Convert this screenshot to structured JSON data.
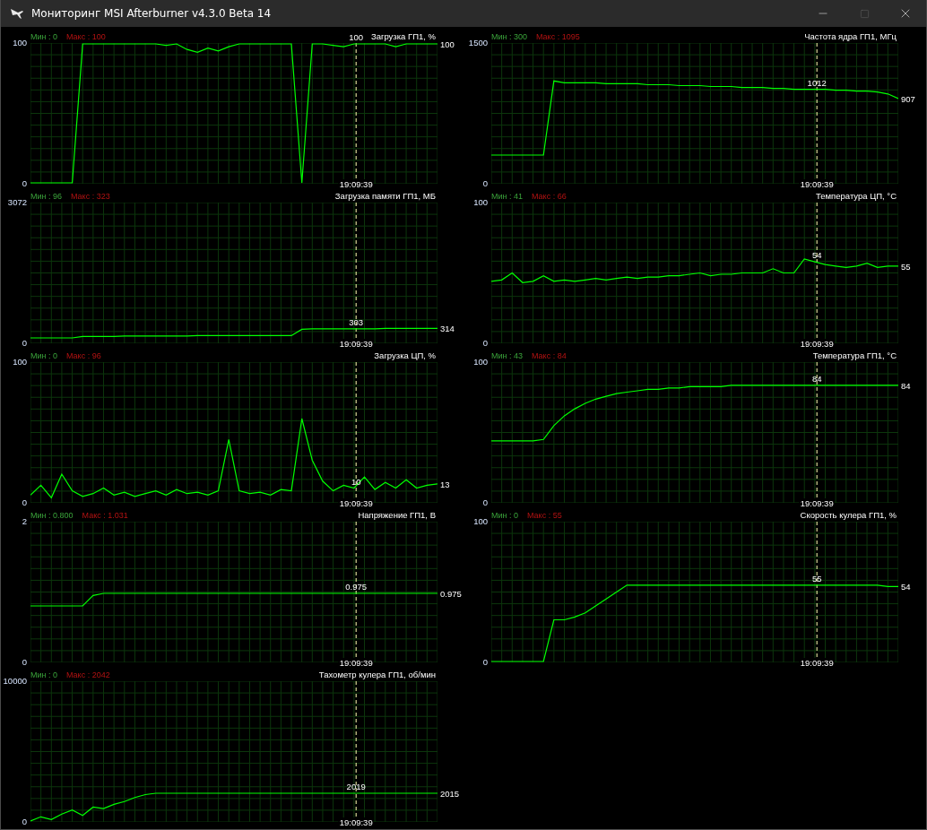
{
  "window": {
    "title": "Мониторинг MSI Afterburner v4.3.0 Beta 14"
  },
  "columns": [
    [
      {
        "min": "Мин : 0",
        "max": "Макс : 100",
        "cursor_value": "100",
        "last_value": "100",
        "time": "19:09:39",
        "chart_data": {
          "type": "line",
          "title": "Загрузка ГП1, %",
          "grid": true,
          "ylim": [
            0,
            100
          ],
          "yticks": [
            0,
            100
          ],
          "series": [
            {
              "color": "#00ff00",
              "values": [
                0,
                0,
                0,
                0,
                0,
                100,
                100,
                100,
                100,
                100,
                100,
                100,
                100,
                99,
                100,
                96,
                94,
                97,
                95,
                98,
                100,
                100,
                100,
                100,
                100,
                100,
                0,
                100,
                100,
                99,
                98,
                100,
                100,
                100,
                100,
                98,
                100,
                100,
                100,
                100
              ]
            }
          ]
        }
      },
      {
        "min": "Мин : 96",
        "max": "Макс : 323",
        "cursor_value": "303",
        "last_value": "314",
        "time": "19:09:39",
        "chart_data": {
          "type": "line",
          "title": "Загрузка памяти ГП1, МБ",
          "grid": true,
          "ylim": [
            0,
            3072
          ],
          "yticks": [
            0,
            3072
          ],
          "series": [
            {
              "color": "#00ff00",
              "values": [
                100,
                100,
                100,
                100,
                100,
                130,
                130,
                130,
                130,
                140,
                140,
                140,
                140,
                140,
                140,
                140,
                150,
                150,
                150,
                150,
                150,
                150,
                150,
                150,
                150,
                150,
                290,
                300,
                300,
                300,
                300,
                300,
                300,
                300,
                310,
                310,
                310,
                310,
                310,
                310
              ]
            }
          ]
        }
      },
      {
        "min": "Мин : 0",
        "max": "Макс : 96",
        "cursor_value": "10",
        "last_value": "13",
        "time": "19:09:39",
        "chart_data": {
          "type": "line",
          "title": "Загрузка ЦП, %",
          "grid": true,
          "ylim": [
            0,
            100
          ],
          "yticks": [
            0,
            100
          ],
          "series": [
            {
              "color": "#00ff00",
              "values": [
                5,
                12,
                3,
                20,
                8,
                4,
                6,
                10,
                5,
                7,
                4,
                6,
                8,
                5,
                9,
                6,
                7,
                5,
                8,
                45,
                8,
                6,
                7,
                5,
                9,
                8,
                60,
                30,
                15,
                8,
                12,
                10,
                18,
                9,
                14,
                10,
                16,
                10,
                12,
                13
              ]
            }
          ]
        }
      },
      {
        "min": "Мин : 0.800",
        "max": "Макс : 1.031",
        "cursor_value": "0.975",
        "last_value": "0.975",
        "time": "19:09:39",
        "chart_data": {
          "type": "line",
          "title": "Напряжение ГП1, В",
          "grid": true,
          "ylim": [
            0,
            2
          ],
          "yticks": [
            0,
            2
          ],
          "series": [
            {
              "color": "#00ff00",
              "values": [
                0.8,
                0.8,
                0.8,
                0.8,
                0.8,
                0.8,
                0.95,
                0.98,
                0.98,
                0.98,
                0.98,
                0.98,
                0.98,
                0.98,
                0.98,
                0.98,
                0.98,
                0.98,
                0.98,
                0.98,
                0.98,
                0.98,
                0.98,
                0.98,
                0.98,
                0.98,
                0.98,
                0.98,
                0.98,
                0.98,
                0.98,
                0.98,
                0.98,
                0.98,
                0.98,
                0.98,
                0.98,
                0.98,
                0.98,
                0.98
              ]
            }
          ]
        }
      },
      {
        "min": "Мин : 0",
        "max": "Макс : 2042",
        "cursor_value": "2019",
        "last_value": "2015",
        "time": "19:09:39",
        "chart_data": {
          "type": "line",
          "title": "Тахометр кулера ГП1, об/мин",
          "grid": true,
          "ylim": [
            0,
            10000
          ],
          "yticks": [
            0,
            10000
          ],
          "series": [
            {
              "color": "#00ff00",
              "values": [
                0,
                300,
                100,
                500,
                800,
                400,
                1000,
                900,
                1200,
                1400,
                1700,
                1900,
                2000,
                2000,
                2000,
                2000,
                2000,
                2000,
                2000,
                2000,
                2000,
                2000,
                2000,
                2000,
                2000,
                2000,
                2000,
                2000,
                2000,
                2000,
                2000,
                2000,
                2000,
                2000,
                2000,
                2000,
                2000,
                2000,
                2000,
                2000
              ]
            }
          ]
        }
      }
    ],
    [
      {
        "min": "Мин : 300",
        "max": "Макс : 1095",
        "cursor_value": "1012",
        "last_value": "907",
        "time": "19:09:39",
        "chart_data": {
          "type": "line",
          "title": "Частота ядра ГП1, МГц",
          "grid": true,
          "ylim": [
            0,
            1500
          ],
          "yticks": [
            0,
            1500
          ],
          "series": [
            {
              "color": "#00ff00",
              "values": [
                300,
                300,
                300,
                300,
                300,
                300,
                1100,
                1080,
                1080,
                1080,
                1080,
                1070,
                1070,
                1070,
                1070,
                1060,
                1060,
                1060,
                1050,
                1050,
                1050,
                1040,
                1040,
                1040,
                1030,
                1030,
                1030,
                1020,
                1020,
                1010,
                1010,
                1010,
                1010,
                1000,
                1000,
                990,
                990,
                980,
                960,
                910
              ]
            }
          ]
        }
      },
      {
        "min": "Мин : 41",
        "max": "Макс : 66",
        "cursor_value": "54",
        "last_value": "55",
        "time": "19:09:39",
        "chart_data": {
          "type": "line",
          "title": "Температура ЦП, °C",
          "grid": true,
          "ylim": [
            0,
            100
          ],
          "yticks": [
            0,
            100
          ],
          "series": [
            {
              "color": "#00ff00",
              "values": [
                44,
                45,
                50,
                43,
                44,
                48,
                44,
                45,
                44,
                45,
                46,
                45,
                46,
                47,
                46,
                47,
                47,
                48,
                48,
                49,
                50,
                48,
                49,
                49,
                50,
                50,
                50,
                53,
                50,
                50,
                60,
                58,
                56,
                55,
                54,
                55,
                57,
                54,
                55,
                55
              ]
            }
          ]
        }
      },
      {
        "min": "Мин : 43",
        "max": "Макс : 84",
        "cursor_value": "84",
        "last_value": "84",
        "time": "19:09:39",
        "chart_data": {
          "type": "line",
          "title": "Температура ГП1, °C",
          "grid": true,
          "ylim": [
            0,
            100
          ],
          "yticks": [
            0,
            100
          ],
          "series": [
            {
              "color": "#00ff00",
              "values": [
                44,
                44,
                44,
                44,
                44,
                45,
                55,
                62,
                67,
                71,
                74,
                76,
                78,
                79,
                80,
                81,
                81,
                82,
                82,
                83,
                83,
                83,
                83,
                84,
                84,
                84,
                84,
                84,
                84,
                84,
                84,
                84,
                84,
                84,
                84,
                84,
                84,
                84,
                84,
                84
              ]
            }
          ]
        }
      },
      {
        "min": "Мин : 0",
        "max": "Макс : 55",
        "cursor_value": "55",
        "last_value": "54",
        "time": "19:09:39",
        "chart_data": {
          "type": "line",
          "title": "Скорость кулера ГП1, %",
          "grid": true,
          "ylim": [
            0,
            100
          ],
          "yticks": [
            0,
            100
          ],
          "series": [
            {
              "color": "#00ff00",
              "values": [
                0,
                0,
                0,
                0,
                0,
                0,
                30,
                30,
                32,
                35,
                40,
                45,
                50,
                55,
                55,
                55,
                55,
                55,
                55,
                55,
                55,
                55,
                55,
                55,
                55,
                55,
                55,
                55,
                55,
                55,
                55,
                55,
                55,
                55,
                55,
                55,
                55,
                55,
                54,
                54
              ]
            }
          ]
        }
      }
    ]
  ]
}
